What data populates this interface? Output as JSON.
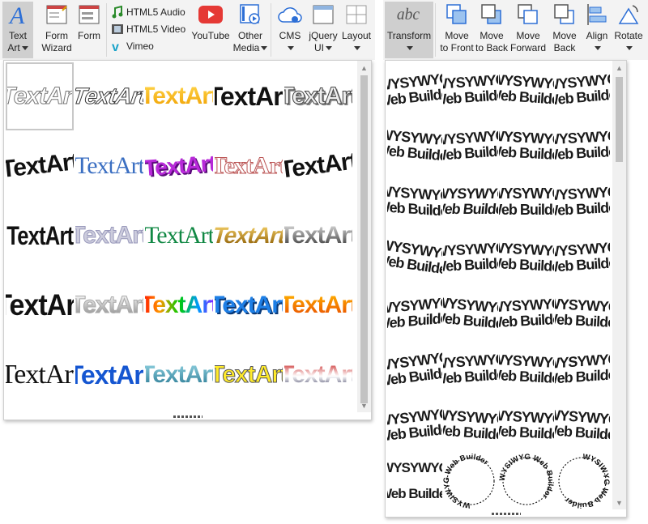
{
  "ribbon_left": {
    "text_art": "Text\nArt",
    "form_wizard": "Form\nWizard",
    "form": "Form",
    "html5_audio": "HTML5 Audio",
    "html5_video": "HTML5 Video",
    "vimeo": "Vimeo",
    "youtube": "YouTube",
    "other_media": "Other\nMedia",
    "cms": "CMS",
    "jquery_ui": "jQuery\nUI",
    "layout": "Layout"
  },
  "ribbon_right": {
    "transform": "Transform",
    "move_to_front": "Move\nto Front",
    "move_to_back": "Move\nto Back",
    "move_forward": "Move\nForward",
    "move_back": "Move\nBack",
    "align": "Align",
    "rotate": "Rotate"
  },
  "textart_gallery": {
    "label": "TextArt",
    "styles": [
      "outline-gray",
      "outline-italic",
      "gold-gradient",
      "black-bold",
      "gray-shadow",
      "black-wave",
      "blue-serif",
      "purple-3d",
      "rainbow-outline",
      "black-tilt",
      "black-condensed",
      "lavender-outline",
      "green-serif",
      "gold-perspective",
      "gray-3d",
      "black-tall",
      "silver-gradient",
      "rainbow-gradient",
      "blue-3d",
      "orange-3d",
      "thin-serif",
      "blue-bold",
      "teal-gradient",
      "yellow-outline",
      "red-chrome"
    ]
  },
  "transform_gallery": {
    "line1": "WYSYWYG",
    "line2": "Web Builder",
    "circle_text": "WYSIWYG Web Builder"
  },
  "colors": {
    "ribbon_bg": "#f3f3f3",
    "selected": "#cfcfcf",
    "accent_blue": "#1e6fd0"
  }
}
